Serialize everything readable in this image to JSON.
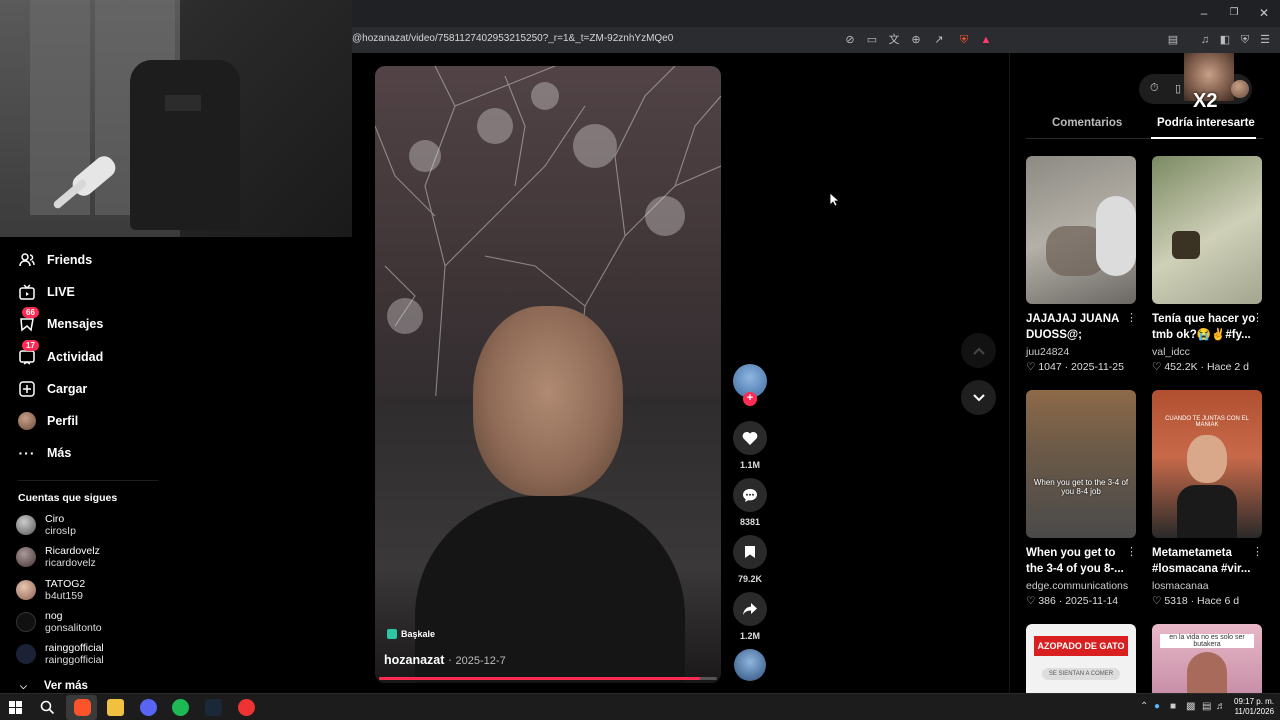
{
  "browser": {
    "url": "@hozanazat/video/7581127402953215250?_r=1&_t=ZM-92znhYzMQe0",
    "window_controls": [
      "minimize",
      "restore",
      "close"
    ]
  },
  "sidebar": {
    "nav": [
      {
        "label": "Friends",
        "icon": "friends-icon"
      },
      {
        "label": "LIVE",
        "icon": "live-icon"
      },
      {
        "label": "Mensajes",
        "icon": "messages-icon",
        "badge": "66"
      },
      {
        "label": "Actividad",
        "icon": "activity-icon",
        "badge": "17"
      },
      {
        "label": "Cargar",
        "icon": "upload-icon"
      },
      {
        "label": "Perfil",
        "icon": "profile-icon"
      },
      {
        "label": "Más",
        "icon": "more-icon"
      }
    ],
    "following_header": "Cuentas que sigues",
    "following": [
      {
        "name": "Ciro",
        "user": "cirosIp"
      },
      {
        "name": "Ricardovelz",
        "user": "ricardovelz"
      },
      {
        "name": "TATOG2",
        "user": "b4ut159"
      },
      {
        "name": "nog",
        "user": "gonsalitonto"
      },
      {
        "name": "rainggofficial",
        "user": "rainggofficial"
      }
    ],
    "see_more": "Ver más"
  },
  "video": {
    "location_tag": "Başkale",
    "author": "hozanazat",
    "date": "2025-12-7",
    "progress": 0.95
  },
  "actions": {
    "likes": "1.1M",
    "comments": "8381",
    "saves": "79.2K",
    "shares": "1.2M"
  },
  "panel": {
    "tabs": [
      "Comentarios",
      "Podría interesarte"
    ],
    "active_tab": 1,
    "overlay_label": "X2",
    "cards": [
      {
        "title": "JAJAJAJ JUANA DUOSS@;",
        "user": "juu24824",
        "likes": "1047",
        "date": "2025-11-25"
      },
      {
        "title": "Tenía que hacer yo tmb ok?😭✌#fy...",
        "user": "val_idcc",
        "likes": "452.2K",
        "date": "Hace 2 d"
      },
      {
        "title": "When you get to the 3-4 of you 8-...",
        "user": "edge.communications",
        "likes": "386",
        "date": "2025-11-14",
        "thumb_text": "When you get to the 3-4 of you 8-4 job"
      },
      {
        "title": "Metametameta #losmacana #vir...",
        "user": "losmacanaa",
        "likes": "5318",
        "date": "Hace 6 d",
        "thumb_text": "CUANDO TE JUNTAS CON EL MANIAK"
      },
      {
        "title": "",
        "user": "",
        "likes": "",
        "date": "",
        "thumb_text": "AZOPADO DE GATO",
        "thumb_sub": "SE SIENTAN A COMER"
      },
      {
        "title": "",
        "user": "",
        "likes": "",
        "date": "",
        "thumb_text": "en la vida no es solo ser butakera"
      }
    ]
  },
  "taskbar": {
    "time": "09:17 p. m.",
    "date": "11/01/2026"
  },
  "colors": {
    "accent": "#fe2c55",
    "background": "#000000"
  }
}
